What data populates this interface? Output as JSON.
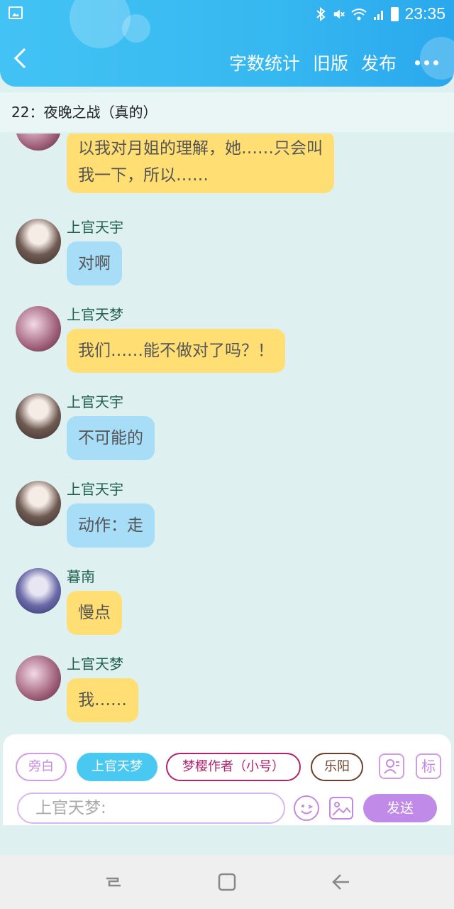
{
  "status": {
    "time": "23:35"
  },
  "header": {
    "word_count": "字数统计",
    "old_version": "旧版",
    "publish": "发布"
  },
  "chapter_title": "22：夜晚之战（真的）",
  "messages": [
    {
      "name": "",
      "text_lines": [
        "以我对月姐的理解，她……只会叫",
        "我一下，所以……"
      ],
      "color": "#ffdf73",
      "avatar": "tianmeng"
    },
    {
      "name": "上官天宇",
      "text": "对啊",
      "color": "#a8ddf8",
      "avatar": "tianyu"
    },
    {
      "name": "上官天梦",
      "text": "我们……能不做对了吗？！",
      "color": "#ffdf73",
      "avatar": "tianmeng"
    },
    {
      "name": "上官天宇",
      "text": "不可能的",
      "color": "#a8ddf8",
      "avatar": "tianyu"
    },
    {
      "name": "上官天宇",
      "text": "动作：走",
      "color": "#a8ddf8",
      "avatar": "tianyu"
    },
    {
      "name": "暮南",
      "text": "慢点",
      "color": "#ffdf73",
      "avatar": "munan"
    },
    {
      "name": "上官天梦",
      "text": "我……",
      "color": "#ffdf73",
      "avatar": "tianmeng"
    }
  ],
  "roles": [
    {
      "label": "旁白",
      "color": "#d29be6"
    },
    {
      "label": "上官天梦",
      "color": "#49c9f2",
      "selected": true
    },
    {
      "label": "梦樱作者（小号）",
      "color": "#b0246e"
    },
    {
      "label": "乐阳",
      "color": "#6b3f2a"
    }
  ],
  "tools": {
    "role_icon": "person-card-icon",
    "mark_label": "标"
  },
  "composer": {
    "placeholder": "上官天梦:",
    "send_label": "发送"
  }
}
